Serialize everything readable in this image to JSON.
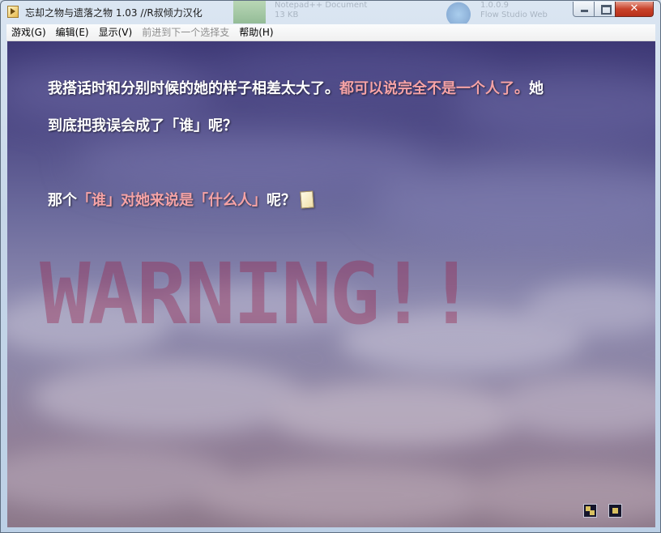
{
  "window": {
    "title": "忘却之物与遗落之物 1.03 //R叔倾力汉化",
    "background_task_1_line1": "Notepad++ Document",
    "background_task_1_line2": "13 KB",
    "background_task_2_line1": "1.0.0.9",
    "background_task_2_line2": "Flow Studio Web",
    "controls": {
      "minimize": "minimize-icon",
      "maximize": "maximize-icon",
      "close": "✕"
    }
  },
  "menubar": {
    "items": [
      {
        "label": "游戏(G)",
        "enabled": true
      },
      {
        "label": "编辑(E)",
        "enabled": true
      },
      {
        "label": "显示(V)",
        "enabled": true
      },
      {
        "label": "前进到下一个选择支",
        "enabled": false
      },
      {
        "label": "帮助(H)",
        "enabled": true
      }
    ]
  },
  "game": {
    "dialogue": {
      "line1_white": "我搭话时和分别时候的她的样子相差太大了。",
      "line1_pink": "都可以说完全不是一个人了。",
      "line1_end": "她",
      "line2": "到底把我误会成了「谁」呢？",
      "line3_start": "那个",
      "line3_pink": "「谁」对她来说是「什么人」",
      "line3_end": "呢？"
    },
    "warning_text": "WARNING!!",
    "highlight_color": "#f6a3a6",
    "text_color": "#ffffff",
    "wait_cursor_icon": "page-cursor-icon",
    "system_buttons": [
      "auto-mode-icon",
      "skip-mode-icon"
    ]
  }
}
